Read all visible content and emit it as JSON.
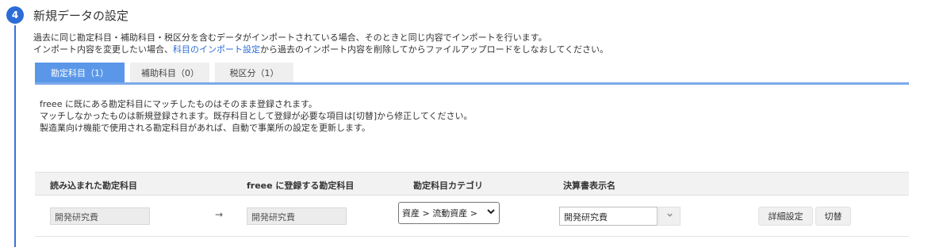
{
  "step": {
    "number": "4",
    "title": "新規データの設定"
  },
  "description": {
    "line1": "過去に同じ勘定科目・補助科目・税区分を含むデータがインポートされている場合、そのときと同じ内容でインポートを行います。",
    "line2_prefix": "インポート内容を変更したい場合、",
    "line2_link": "科目のインポート設定",
    "line2_suffix": "から過去のインポート内容を削除してからファイルアップロードをしなおしてください。"
  },
  "tabs": [
    {
      "label": "勘定科目（1）",
      "active": true
    },
    {
      "label": "補助科目（0）",
      "active": false
    },
    {
      "label": "税区分（1）",
      "active": false
    }
  ],
  "info": {
    "line1": "freee に既にある勘定科目にマッチしたものはそのまま登録されます。",
    "line2": "マッチしなかったものは新規登録されます。既存科目として登録が必要な項目は[切替]から修正してください。",
    "line3": "製造業向け機能で使用される勘定科目があれば、自動で事業所の設定を更新します。"
  },
  "table": {
    "headers": {
      "imported": "読み込まれた勘定科目",
      "freee": "freee に登録する勘定科目",
      "category": "勘定科目カテゴリ",
      "display_name": "決算書表示名"
    },
    "row": {
      "imported_value": "開発研究費",
      "arrow": "→",
      "freee_value": "開発研究費",
      "category_value": "資産 > 流動資産 >",
      "display_value": "開発研究費",
      "detail_button": "詳細設定",
      "switch_button": "切替"
    }
  },
  "colors": {
    "accent": "#2c6cd6",
    "active_tab": "#5a97e8",
    "tab_underline": "#7ba9ec"
  },
  "icons": {
    "select_chevron": "chevron-down-icon",
    "dropdown": "caret-down-icon",
    "arrow": "arrow-right-icon"
  }
}
